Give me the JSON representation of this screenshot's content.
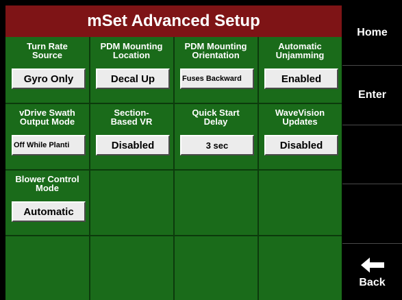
{
  "header": {
    "title": "mSet Advanced Setup"
  },
  "settings": [
    {
      "label": "Turn Rate\nSource",
      "value": "Gyro Only"
    },
    {
      "label": "PDM Mounting\nLocation",
      "value": "Decal Up"
    },
    {
      "label": "PDM Mounting\nOrientation",
      "value": "Fuses Backward"
    },
    {
      "label": "Automatic\nUnjamming",
      "value": "Enabled"
    },
    {
      "label": "vDrive Swath\nOutput Mode",
      "value": "Off While Planti"
    },
    {
      "label": "Section-\nBased VR",
      "value": "Disabled"
    },
    {
      "label": "Quick Start\nDelay",
      "value": "3 sec"
    },
    {
      "label": "WaveVision\nUpdates",
      "value": "Disabled"
    },
    {
      "label": "Blower Control\nMode",
      "value": "Automatic"
    }
  ],
  "side_buttons": {
    "home": "Home",
    "enter": "Enter",
    "back": "Back",
    "back_icon": "left-arrow-icon"
  },
  "colors": {
    "title_bar": "#7e1416",
    "grid_green": "#1a6b1a",
    "value_box": "#ececec"
  }
}
